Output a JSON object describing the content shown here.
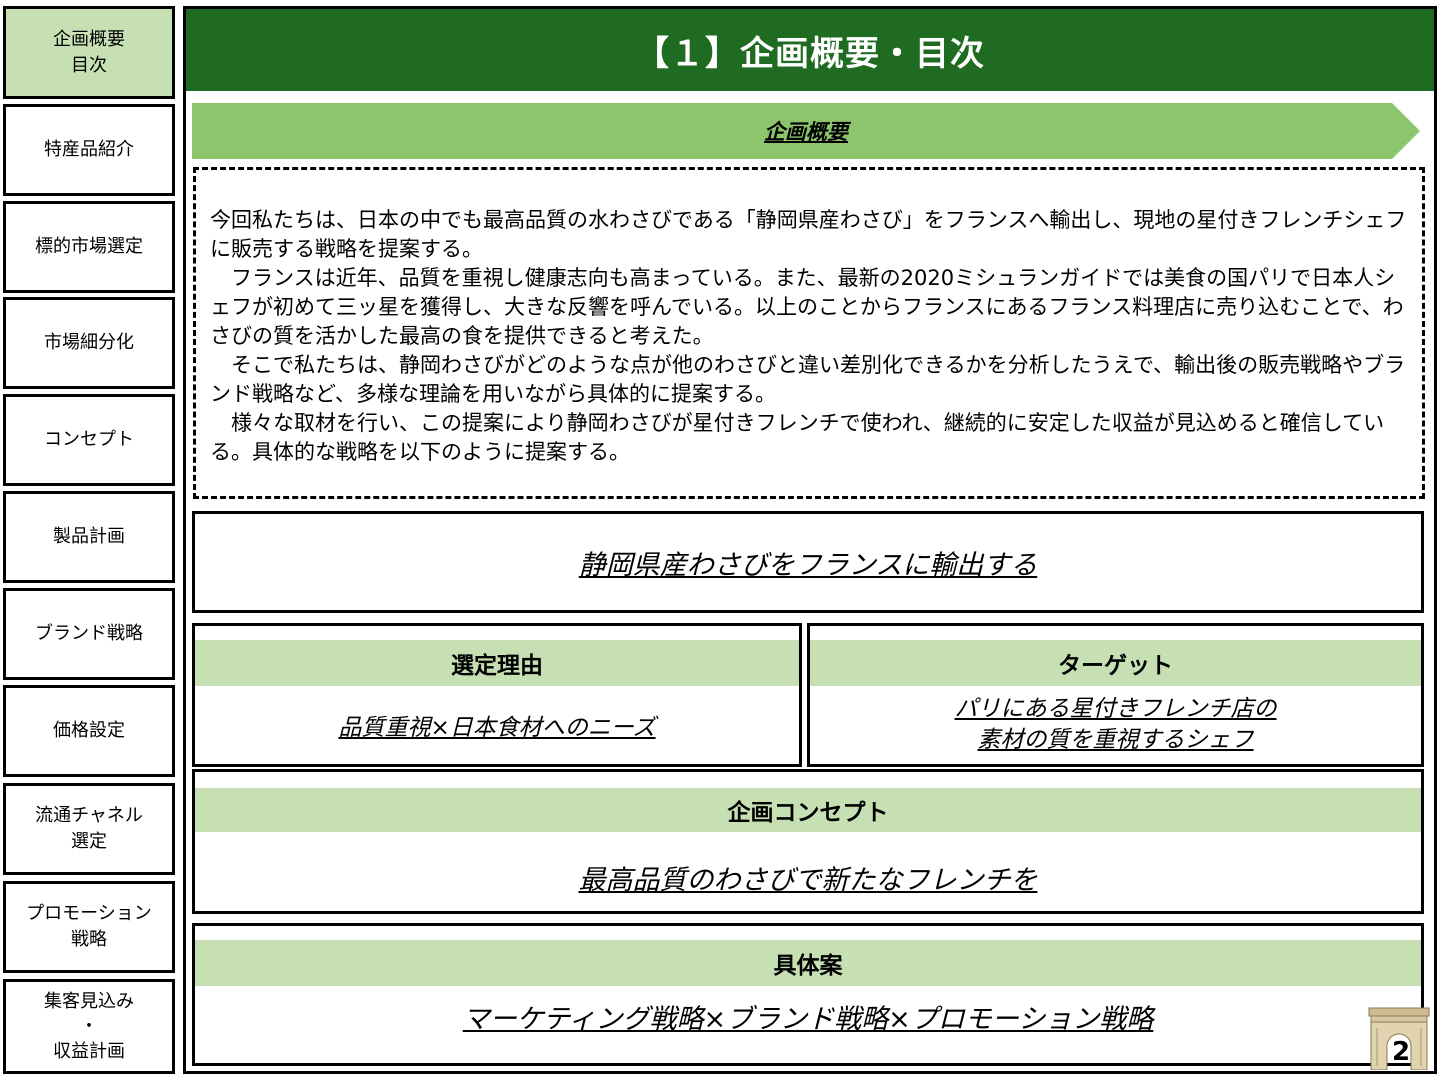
{
  "sidebar": {
    "items": [
      {
        "label": "企画概要\n目次",
        "active": true
      },
      {
        "label": "特産品紹介"
      },
      {
        "label": "標的市場選定"
      },
      {
        "label": "市場細分化"
      },
      {
        "label": "コンセプト"
      },
      {
        "label": "製品計画"
      },
      {
        "label": "ブランド戦略"
      },
      {
        "label": "価格設定"
      },
      {
        "label": "流通チャネル\n選定"
      },
      {
        "label": "プロモーション\n戦略"
      },
      {
        "label": "集客見込み\n・\n収益計画"
      }
    ]
  },
  "header": {
    "title": "【１】企画概要・目次"
  },
  "overview": {
    "banner": "企画概要",
    "paragraphs": [
      "今回私たちは、日本の中でも最高品質の水わさびである「静岡県産わさび」をフランスへ輸出し、現地の星付きフレンチシェフに販売する戦略を提案する。",
      "　フランスは近年、品質を重視し健康志向も高まっている。また、最新の2020ミシュランガイドでは美食の国パリで日本人シェフが初めて三ッ星を獲得し、大きな反響を呼んでいる。以上のことからフランスにあるフランス料理店に売り込むことで、わさびの質を活かした最高の食を提供できると考えた。",
      "　そこで私たちは、静岡わさびがどのような点が他のわさびと違い差別化できるかを分析したうえで、輸出後の販売戦略やブランド戦略など、多様な理論を用いながら具体的に提案する。",
      "　様々な取材を行い、この提案により静岡わさびが星付きフレンチで使われ、継続的に安定した収益が見込めると確信している。具体的な戦略を以下のように提案する。"
    ]
  },
  "goal": {
    "text": "静岡県産わさびをフランスに輸出する"
  },
  "reason": {
    "heading": "選定理由",
    "text": "品質重視×日本食材へのニーズ"
  },
  "target": {
    "heading": "ターゲット",
    "line1": "パリにある星付きフレンチ店の",
    "line2": "素材の質を重視するシェフ"
  },
  "concept": {
    "heading": "企画コンセプト",
    "text": "最高品質のわさびで新たなフレンチを"
  },
  "plan": {
    "heading": "具体案",
    "text": "マーケティング戦略×ブランド戦略×プロモーション戦略"
  },
  "page": {
    "number": "2"
  },
  "colors": {
    "header_green": "#1e6b21",
    "light_green": "#c6e0b4",
    "arrow_green": "#8cc56b"
  }
}
